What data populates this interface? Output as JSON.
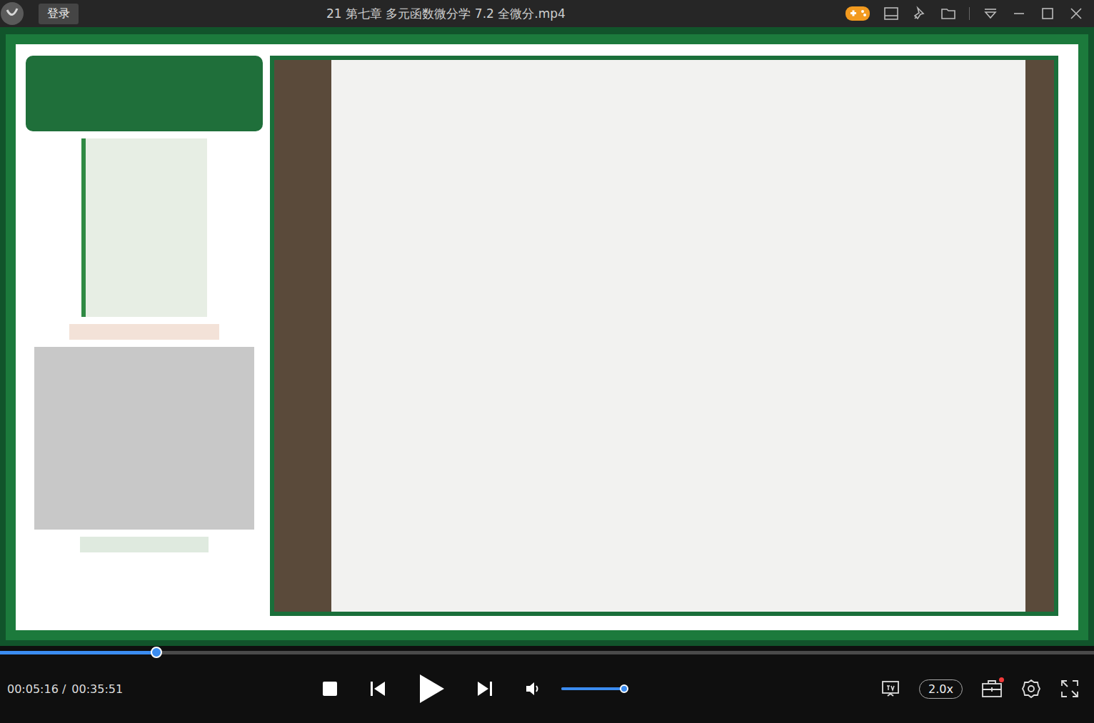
{
  "window": {
    "title": "21 第七章 多元函数微分学 7.2 全微分.mp4"
  },
  "login_button": "登录",
  "progress": {
    "level": 0.143
  },
  "time": {
    "current": "00:05:16 /",
    "total": "00:35:51"
  },
  "volume": {
    "level": 1.0
  },
  "speed": "2.0x",
  "playing": false,
  "toolbox": {
    "notification": true
  }
}
